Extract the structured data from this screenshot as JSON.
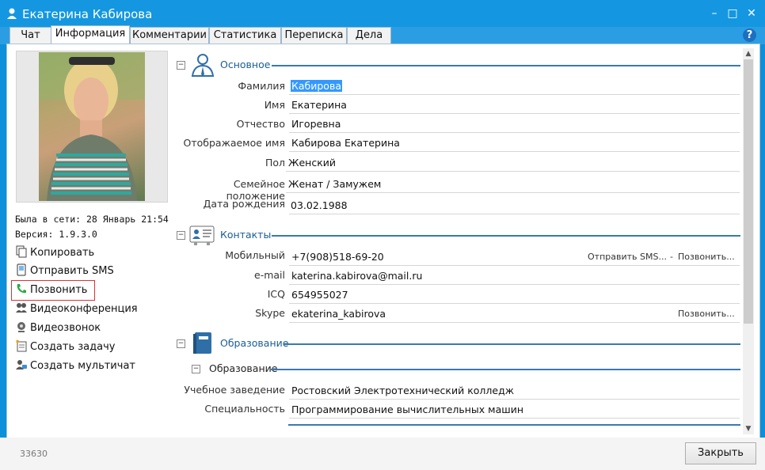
{
  "window": {
    "title": "Екатерина Кабирова",
    "min": "–",
    "max": "□",
    "close": "✕"
  },
  "tabs": [
    {
      "label": "Чат"
    },
    {
      "label": "Информация"
    },
    {
      "label": "Комментарии"
    },
    {
      "label": "Статистика"
    },
    {
      "label": "Переписка"
    },
    {
      "label": "Дела"
    }
  ],
  "help": "?",
  "left": {
    "last_seen": "Была в сети: 28 Январь 21:54",
    "version": "Версия: 1.9.3.0",
    "actions": [
      {
        "label": "Копировать",
        "icon": "copy-icon"
      },
      {
        "label": "Отправить SMS",
        "icon": "sms-icon"
      },
      {
        "label": "Позвонить",
        "icon": "phone-icon"
      },
      {
        "label": "Видеоконференция",
        "icon": "video-conference-icon"
      },
      {
        "label": "Видеозвонок",
        "icon": "webcam-icon"
      },
      {
        "label": "Создать задачу",
        "icon": "task-icon"
      },
      {
        "label": "Создать мультичат",
        "icon": "multichat-icon"
      }
    ]
  },
  "sections": {
    "basic": {
      "title": "Основное",
      "fields": [
        {
          "label": "Фамилия",
          "value": "Кабирова"
        },
        {
          "label": "Имя",
          "value": "Екатерина"
        },
        {
          "label": "Отчество",
          "value": "Игоревна"
        },
        {
          "label": "Отображаемое имя",
          "value": "Кабирова Екатерина"
        },
        {
          "label": "Пол",
          "value": "Женский"
        },
        {
          "label": "Семейное положение",
          "value": "Женат / Замужем"
        },
        {
          "label": "Дата рождения",
          "value": "03.02.1988"
        }
      ]
    },
    "contacts": {
      "title": "Контакты",
      "fields": [
        {
          "label": "Мобильный",
          "value": "+7(908)518-69-20",
          "link1": "Отправить SMS...",
          "sep": "-",
          "link2": "Позвонить..."
        },
        {
          "label": "e-mail",
          "value": "katerina.kabirova@mail.ru"
        },
        {
          "label": "ICQ",
          "value": "654955027"
        },
        {
          "label": "Skype",
          "value": "ekaterina_kabirova",
          "link2": "Позвонить..."
        }
      ]
    },
    "education": {
      "title": "Образование",
      "sub_title": "Образование",
      "fields": [
        {
          "label": "Учебное заведение",
          "value": "Ростовский Электротехнический колледж"
        },
        {
          "label": "Специальность",
          "value": "Программирование вычислительных машин"
        }
      ]
    }
  },
  "footer": {
    "id": "33630",
    "close_label": "Закрыть"
  }
}
